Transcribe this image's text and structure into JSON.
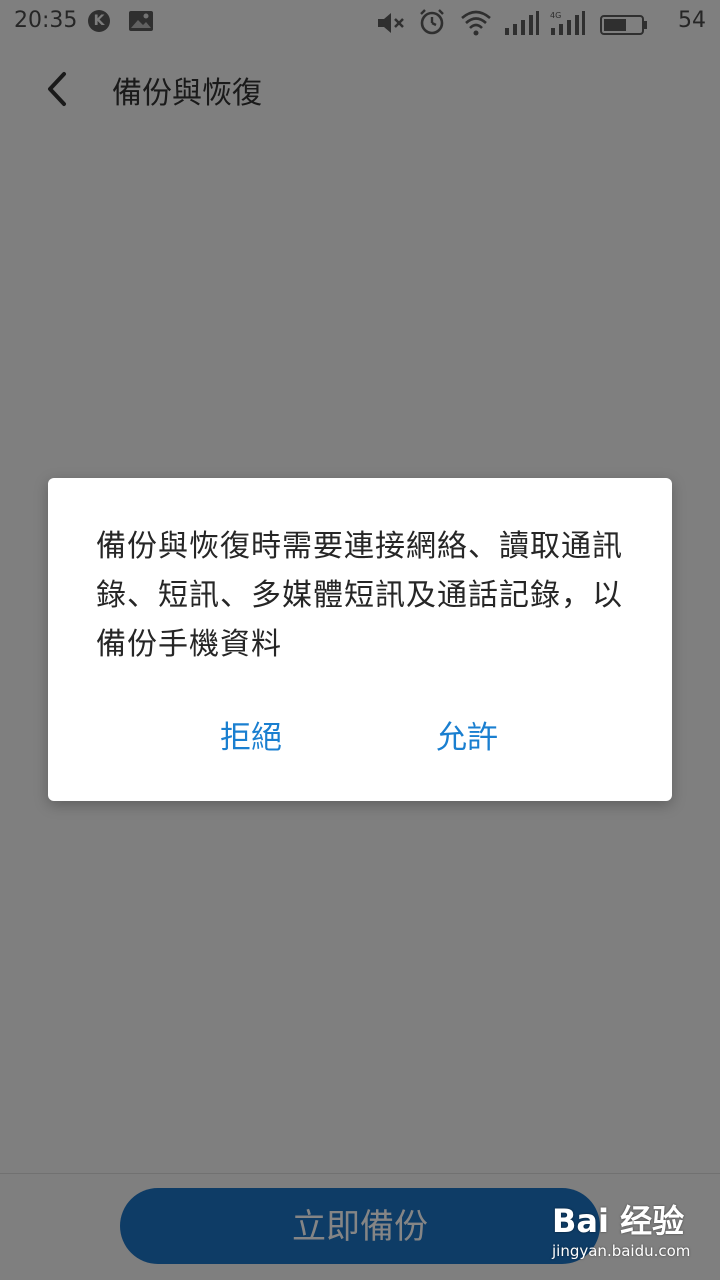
{
  "status_bar": {
    "time": "20:35",
    "notification_badge": "K",
    "battery_level": "54",
    "icons": [
      "k-badge-icon",
      "image-notification-icon",
      "mute-icon",
      "alarm-icon",
      "wifi-icon",
      "signal-icon",
      "4g-signal-icon",
      "battery-icon"
    ]
  },
  "header": {
    "title": "備份與恢復",
    "back_icon": "chevron-left-icon"
  },
  "bottom": {
    "backup_label": "立即備份"
  },
  "dialog": {
    "message": "備份與恢復時需要連接網絡、讀取通訊錄、短訊、多媒體短訊及通話記錄，以備份手機資料",
    "deny_label": "拒絕",
    "allow_label": "允許"
  },
  "watermark": {
    "logo": "Bai 经验",
    "url": "jingyan.baidu.com"
  },
  "colors": {
    "accent": "#1a7fd0",
    "button_bg": "#1c73c4",
    "overlay": "rgba(0,0,0,0.48)"
  }
}
